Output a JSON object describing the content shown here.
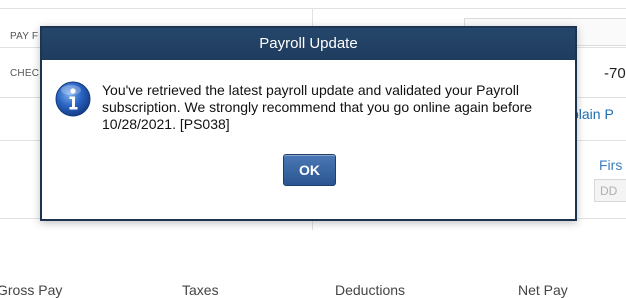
{
  "background": {
    "pay_label": "PAY F",
    "check_label": "CHEC",
    "amount": "-70",
    "explain_link": "plain P",
    "first_label": "Firs",
    "date_placeholder": "DD",
    "footer": {
      "gross_pay": "Gross Pay",
      "taxes": "Taxes",
      "deductions": "Deductions",
      "net_pay": "Net Pay"
    }
  },
  "dialog": {
    "title": "Payroll Update",
    "icon": "info-icon",
    "message": "You've retrieved the latest payroll update and validated your Payroll subscription. We strongly recommend that you go online again before 10/28/2021. [PS038]",
    "ok_label": "OK"
  },
  "colors": {
    "titlebar": "#1e3c5e",
    "button": "#2a5591",
    "link": "#1f6fb5"
  }
}
